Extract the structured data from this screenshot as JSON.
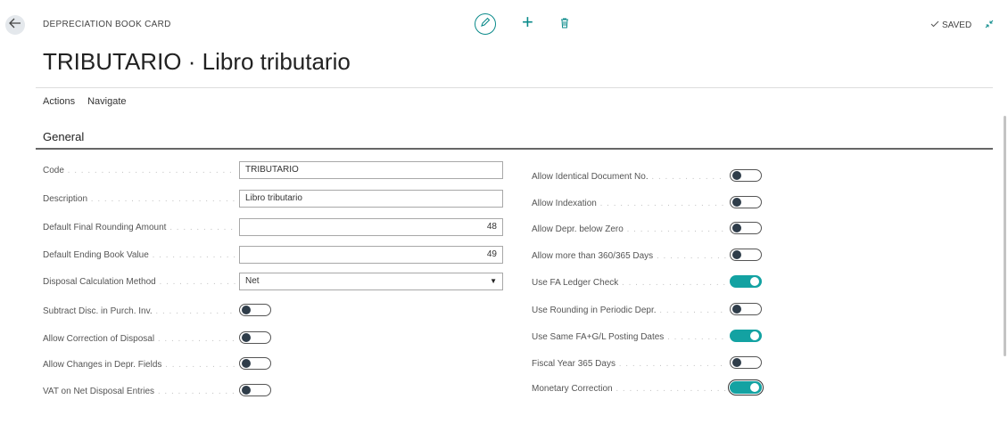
{
  "header": {
    "caption": "DEPRECIATION BOOK CARD",
    "saved_label": "SAVED",
    "title": "TRIBUTARIO · Libro tributario"
  },
  "icons": {
    "back": "arrow-left-icon",
    "edit": "pencil-icon",
    "new": "plus-icon",
    "delete": "trash-icon",
    "saved": "checkmark-icon",
    "collapse": "collapse-arrows-icon"
  },
  "menu": {
    "actions": "Actions",
    "navigate": "Navigate"
  },
  "section": {
    "title": "General"
  },
  "left": {
    "code": {
      "label": "Code",
      "value": "TRIBUTARIO"
    },
    "description": {
      "label": "Description",
      "value": "Libro tributario"
    },
    "final_rounding": {
      "label": "Default Final Rounding Amount",
      "value": "48"
    },
    "ending_book_value": {
      "label": "Default Ending Book Value",
      "value": "49"
    },
    "disposal_method": {
      "label": "Disposal Calculation Method",
      "value": "Net"
    },
    "subtract_disc": {
      "label": "Subtract Disc. in Purch. Inv.",
      "on": false
    },
    "allow_correction": {
      "label": "Allow Correction of Disposal",
      "on": false
    },
    "allow_changes": {
      "label": "Allow Changes in Depr. Fields",
      "on": false
    },
    "vat_net": {
      "label": "VAT on Net Disposal Entries",
      "on": false
    }
  },
  "right": {
    "identical_doc": {
      "label": "Allow Identical Document No.",
      "on": false
    },
    "indexation": {
      "label": "Allow Indexation",
      "on": false
    },
    "below_zero": {
      "label": "Allow Depr. below Zero",
      "on": false
    },
    "more_than_365": {
      "label": "Allow more than 360/365 Days",
      "on": false
    },
    "ledger_check": {
      "label": "Use FA Ledger Check",
      "on": true
    },
    "rounding_periodic": {
      "label": "Use Rounding in Periodic Depr.",
      "on": false
    },
    "same_dates": {
      "label": "Use Same FA+G/L Posting Dates",
      "on": true
    },
    "fiscal_365": {
      "label": "Fiscal Year 365 Days",
      "on": false
    },
    "monetary": {
      "label": "Monetary Correction",
      "on": true
    }
  },
  "colors": {
    "accent": "#13a2a2",
    "text": "#333333",
    "rule": "#666666"
  }
}
